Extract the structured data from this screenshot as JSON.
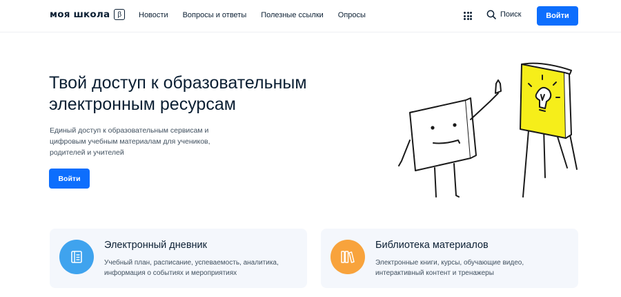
{
  "header": {
    "logo_text": "моя школа",
    "logo_badge": "β",
    "nav": [
      "Новости",
      "Вопросы и ответы",
      "Полезные ссылки",
      "Опросы"
    ],
    "search_label": "Поиск",
    "login_label": "Войти"
  },
  "hero": {
    "title": "Твой доступ к образовательным электронным ресурсам",
    "subtitle": "Единый доступ к образовательным сервисам и цифровым учебным материалам для учеников, родителей и учителей",
    "button_label": "Войти"
  },
  "cards": [
    {
      "title": "Электронный дневник",
      "description": "Учебный план, расписание, успеваемость, аналитика, информация о событиях и мероприятиях",
      "icon": "diary-icon",
      "color": "#3fa3ee"
    },
    {
      "title": "Библиотека материалов",
      "description": "Электронные книги, курсы, обучающие видео, интерактивный контент и тренажеры",
      "icon": "books-icon",
      "color": "#f8a33c"
    }
  ],
  "colors": {
    "primary": "#0d6efd",
    "text": "#0b1f33",
    "card_bg": "#f4f7fc",
    "flipchart": "#f6ee1a"
  }
}
